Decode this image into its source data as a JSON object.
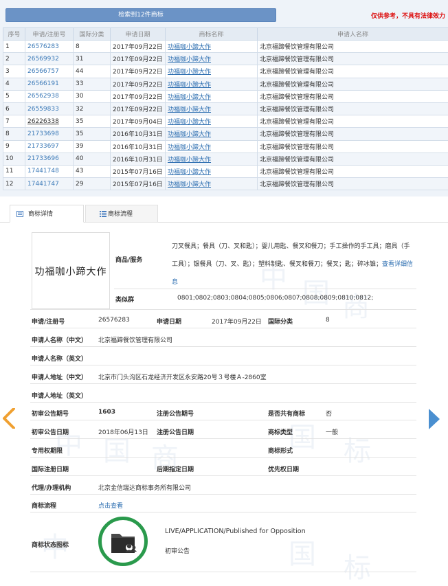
{
  "search": {
    "result_label": "检索到12件商标",
    "disclaimer": "仅供参考，不具有法律效力"
  },
  "table": {
    "headers": [
      "序号",
      "申请/注册号",
      "国际分类",
      "申请日期",
      "商标名称",
      "申请人名称"
    ],
    "rows": [
      [
        "1",
        "26576283",
        "8",
        "2017年09月22日",
        "功福咖小蹄大作",
        "北京福蹄餐饮管理有限公司"
      ],
      [
        "2",
        "26569932",
        "31",
        "2017年09月22日",
        "功福咖小蹄大作",
        "北京福蹄餐饮管理有限公司"
      ],
      [
        "3",
        "26566757",
        "44",
        "2017年09月22日",
        "功福咖小蹄大作",
        "北京福蹄餐饮管理有限公司"
      ],
      [
        "4",
        "26566191",
        "33",
        "2017年09月22日",
        "功福咖小蹄大作",
        "北京福蹄餐饮管理有限公司"
      ],
      [
        "5",
        "26562938",
        "30",
        "2017年09月22日",
        "功福咖小蹄大作",
        "北京福蹄餐饮管理有限公司"
      ],
      [
        "6",
        "26559833",
        "32",
        "2017年09月22日",
        "功福咖小蹄大作",
        "北京福蹄餐饮管理有限公司"
      ],
      [
        "7",
        "26226338",
        "35",
        "2017年09月04日",
        "功福咖小蹄大作",
        "北京福蹄餐饮管理有限公司"
      ],
      [
        "8",
        "21733698",
        "35",
        "2016年10月31日",
        "功福咖小蹄大作",
        "北京福蹄餐饮管理有限公司"
      ],
      [
        "9",
        "21733697",
        "39",
        "2016年10月31日",
        "功福咖小蹄大作",
        "北京福蹄餐饮管理有限公司"
      ],
      [
        "10",
        "21733696",
        "40",
        "2016年10月31日",
        "功福咖小蹄大作",
        "北京福蹄餐饮管理有限公司"
      ],
      [
        "11",
        "17441748",
        "43",
        "2015年07月16日",
        "功福咖小蹄大作",
        "北京福蹄餐饮管理有限公司"
      ],
      [
        "12",
        "17441747",
        "29",
        "2015年07月16日",
        "功福咖小蹄大作",
        "北京福蹄餐饮管理有限公司"
      ]
    ]
  },
  "tabs": {
    "detail": "商标详情",
    "flow": "商标流程"
  },
  "detail": {
    "logo_text": "功福咖小蹄大作",
    "goods_label": "商品/服务",
    "goods_text": "刀叉餐具；餐具（刀、叉和匙）；婴儿用匙、餐叉和餐刀；手工操作的手工具；磨具（手工具）；银餐具（刀、叉、匙）；塑料制匙、餐叉和餐刀；餐叉；匙；碎冰锥；",
    "goods_more": "查看详细信息",
    "similar_label": "类似群",
    "similar_value": "0801;0802;0803;0804;0805;0806;0807;0808;0809;0810;0812;",
    "reg_no_label": "申请/注册号",
    "reg_no": "26576283",
    "app_date_label": "申请日期",
    "app_date": "2017年09月22日",
    "class_label": "国际分类",
    "class_value": "8",
    "applicant_cn_label": "申请人名称（中文）",
    "applicant_cn": "北京福蹄餐饮管理有限公司",
    "applicant_en_label": "申请人名称（英文）",
    "address_cn_label": "申请人地址（中文）",
    "address_cn": "北京市门头沟区石龙经济开发区永安路20号３号楼Ａ-2860室",
    "address_en_label": "申请人地址（英文）",
    "pub_no_label": "初审公告期号",
    "pub_no": "1603",
    "reg_pub_no_label": "注册公告期号",
    "shared_label": "是否共有商标",
    "shared_value": "否",
    "pub_date_label": "初审公告日期",
    "pub_date": "2018年06月13日",
    "reg_pub_date_label": "注册公告日期",
    "tm_type_label": "商标类型",
    "tm_type": "一般",
    "exclusive_label": "专用权期限",
    "tm_form_label": "商标形式",
    "intl_date_label": "国际注册日期",
    "later_date_label": "后期指定日期",
    "priority_label": "优先权日期",
    "agent_label": "代理/办理机构",
    "agent": "北京金信瑞达商标事务所有限公司",
    "flow_label": "商标流程",
    "flow_link": "点击查看",
    "status_label": "商标状态图标",
    "status_en": "LIVE/APPLICATION/Published for Opposition",
    "status_cn": "初审公告"
  },
  "colors": {
    "header_bar": "#6b93c6",
    "disclaimer": "#dd1111",
    "link": "#2b6db0",
    "arrow_left": "#f0a030",
    "arrow_right": "#4a8fd0",
    "status_ring": "#2a9a4c"
  }
}
